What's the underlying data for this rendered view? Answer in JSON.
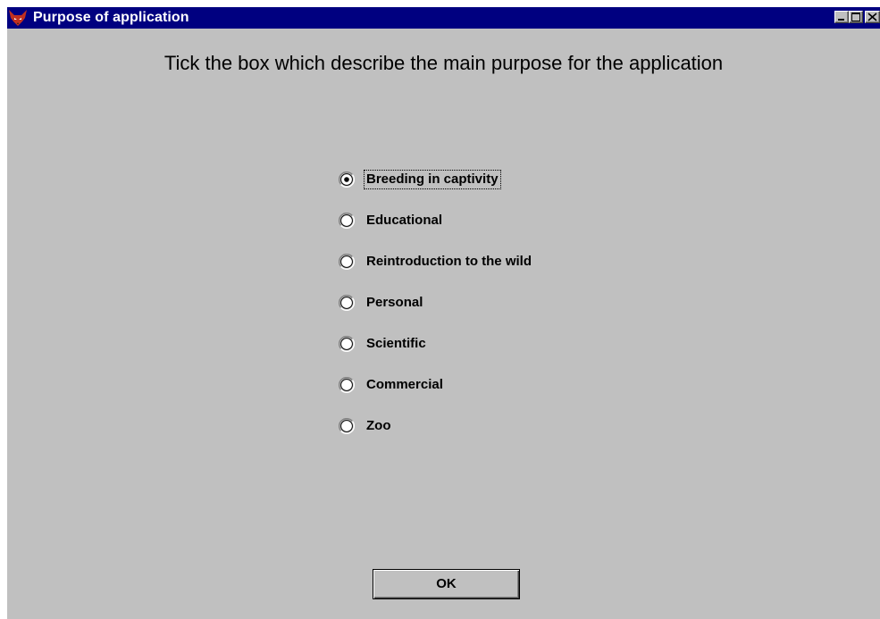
{
  "window": {
    "title": "Purpose of application"
  },
  "instruction": "Tick the box which describe the main purpose for the application",
  "purpose_options": [
    {
      "label": "Breeding in captivity",
      "selected": true
    },
    {
      "label": "Educational",
      "selected": false
    },
    {
      "label": "Reintroduction to the wild",
      "selected": false
    },
    {
      "label": "Personal",
      "selected": false
    },
    {
      "label": "Scientific",
      "selected": false
    },
    {
      "label": "Commercial",
      "selected": false
    },
    {
      "label": "Zoo",
      "selected": false
    }
  ],
  "ok_button": {
    "label": "OK"
  },
  "colors": {
    "title_bar": "#000080",
    "window_face": "#c0c0c0"
  }
}
